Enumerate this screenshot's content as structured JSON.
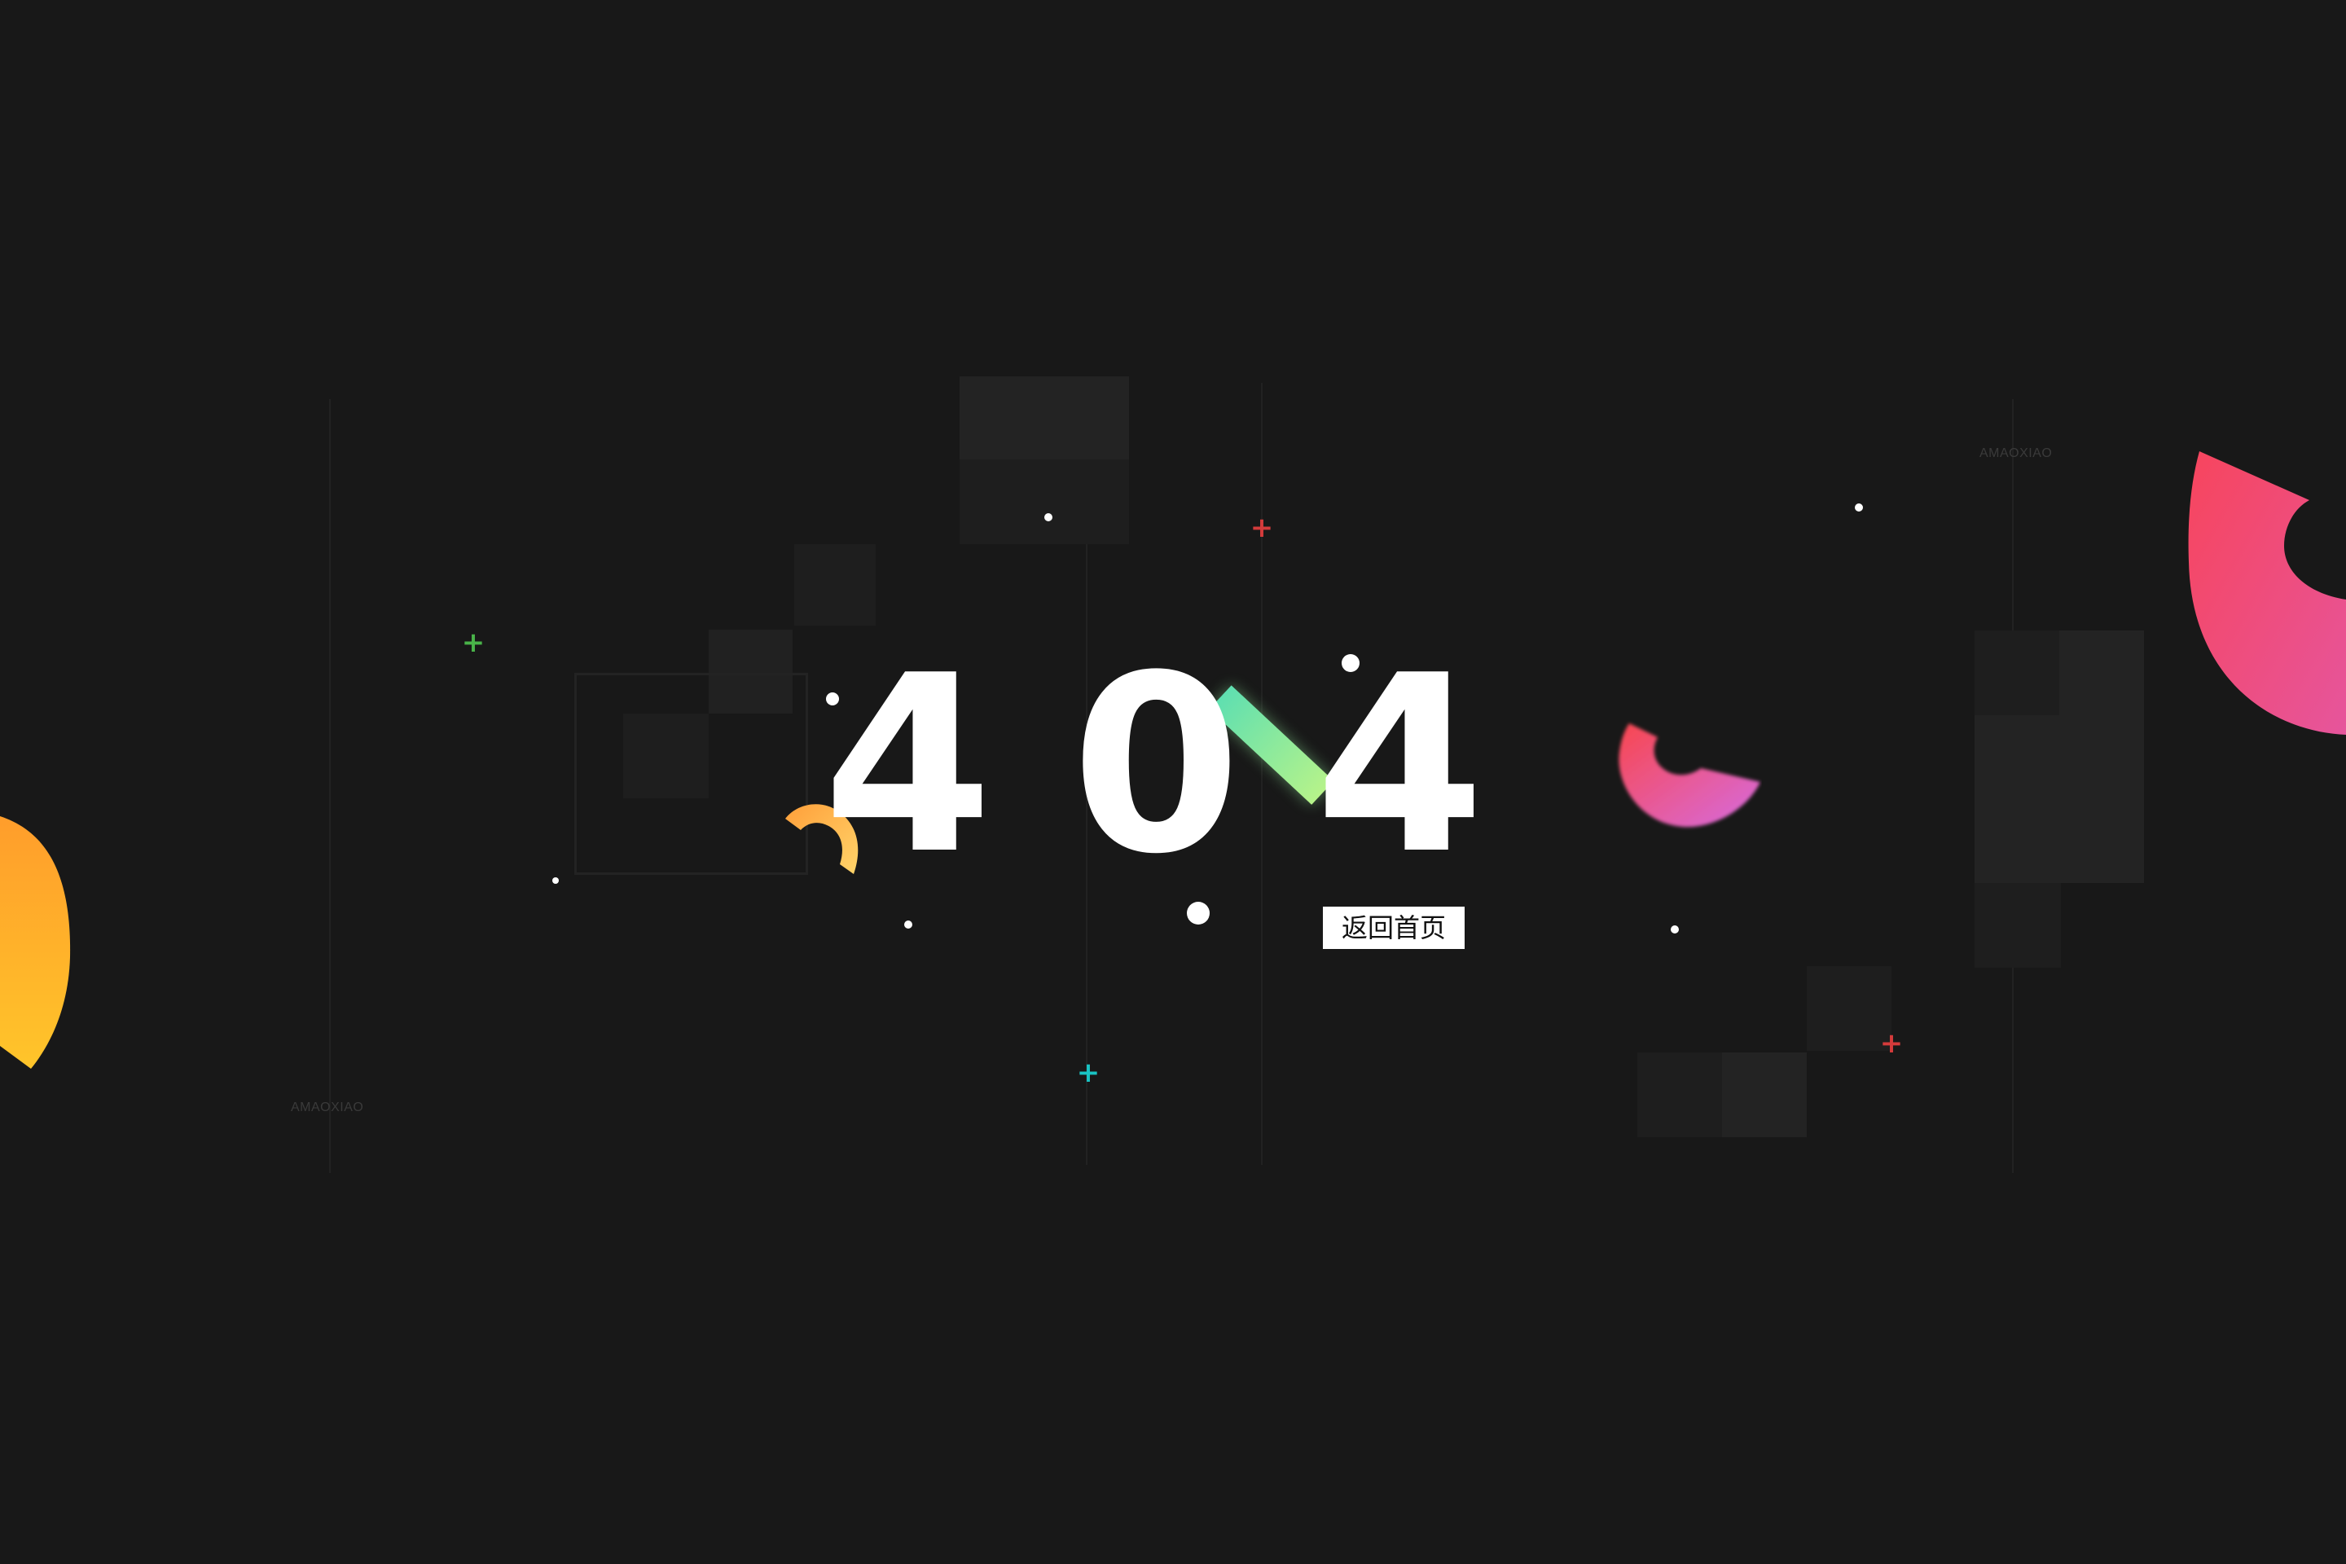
{
  "error_page": {
    "digits": [
      "4",
      "0",
      "4"
    ],
    "home_button_label": "返回首页",
    "watermark_top": "AMAOXIAO",
    "watermark_bottom": "AMAOXIAO"
  },
  "colors": {
    "background": "#181818",
    "digit": "#ffffff",
    "plus_green": "#49b349",
    "plus_red": "#d43b3b",
    "plus_cyan": "#19c3c3",
    "arc_orange": "#ffb028",
    "arc_pink": "#f2456a",
    "bar_green": "#7ee8ae"
  },
  "icons": [
    "plus-icon",
    "arc-shape",
    "dot-shape",
    "bar-shape"
  ]
}
